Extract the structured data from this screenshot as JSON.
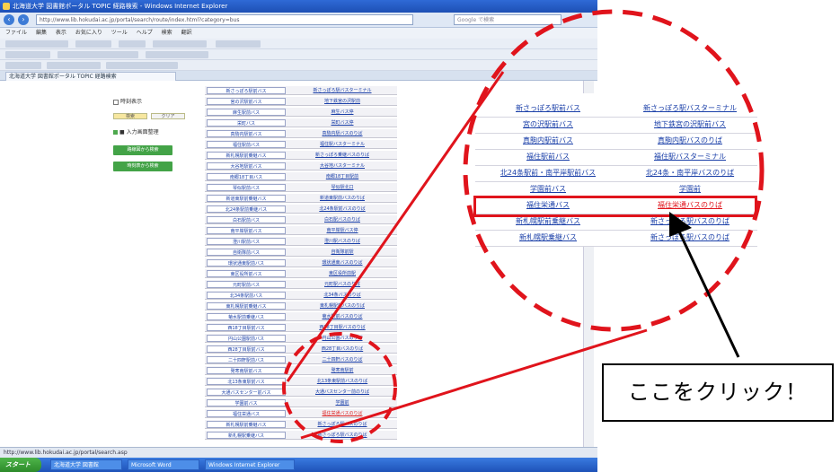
{
  "window": {
    "title": "北海道大学 図書館ポータル TOPIC 経路検索 - Windows Internet Explorer",
    "url": "http://www.lib.hokudai.ac.jp/portal/search/route/index.html?category=bus",
    "search_placeholder": "Google で検索"
  },
  "menubar": [
    "ファイル",
    "編集",
    "表示",
    "お気に入り",
    "ツール",
    "ヘルプ",
    "検索",
    "翻訳"
  ],
  "tab": {
    "label": "北海道大学 図書館ポータル TOPIC 経路検索"
  },
  "left_panel": {
    "checkbox_label": "時刻表示",
    "mini_buttons": [
      "検索",
      "クリア"
    ],
    "green_label": "■ 入力画面整理",
    "green_buttons": [
      "路線図から検索",
      "時刻表から検索"
    ]
  },
  "route_table": [
    {
      "left": "新さっぽろ駅前バス",
      "right": "新さっぽろ駅バスターミナル",
      "red": false
    },
    {
      "left": "宮の沢駅前バス",
      "right": "地下鉄宮の沢駅前",
      "red": false
    },
    {
      "left": "麻生駅前バス",
      "right": "麻生バス停",
      "red": false
    },
    {
      "left": "栄町バス",
      "right": "栄町バス停",
      "red": false
    },
    {
      "left": "真駒内駅前バス",
      "right": "真駒内駅バスのりば",
      "red": false
    },
    {
      "left": "福住駅前バス",
      "right": "福住駅バスターミナル",
      "red": false
    },
    {
      "left": "新札幌駅前乗継バス",
      "right": "新さっぽろ乗継バスのりば",
      "red": false
    },
    {
      "left": "大谷地駅前バス",
      "right": "大谷地バスターミナル",
      "red": false
    },
    {
      "left": "南郷18丁目バス",
      "right": "南郷18丁目駅前",
      "red": false
    },
    {
      "left": "琴似駅前バス",
      "right": "琴似駅北口",
      "red": false
    },
    {
      "left": "新道東駅前乗継バス",
      "right": "新道東駅前バスのりば",
      "red": false
    },
    {
      "left": "北24条駅前乗継バス",
      "right": "北24条駅前バスのりば",
      "red": false
    },
    {
      "left": "白石駅前バス",
      "right": "白石駅バスのりば",
      "red": false
    },
    {
      "left": "南平岸駅前バス",
      "right": "南平岸駅バス停",
      "red": false
    },
    {
      "left": "澄川駅前バス",
      "right": "澄川駅バスのりば",
      "red": false
    },
    {
      "left": "自衛隊前バス",
      "right": "自衛隊前駅",
      "red": false
    },
    {
      "left": "環状通東駅前バス",
      "right": "環状通東バスのりば",
      "red": false
    },
    {
      "left": "東区役所前バス",
      "right": "東区役所前駅",
      "red": false
    },
    {
      "left": "元町駅前バス",
      "right": "元町駅バスのりば",
      "red": false
    },
    {
      "left": "北34条駅前バス",
      "right": "北34条バスのりば",
      "red": false
    },
    {
      "left": "東札幌駅前乗継バス",
      "right": "東札幌駅前バスのりば",
      "red": false
    },
    {
      "left": "菊水駅前乗継バス",
      "right": "菊水駅前バスのりば",
      "red": false
    },
    {
      "left": "西18丁目駅前バス",
      "right": "西18丁目駅バスのりば",
      "red": false
    },
    {
      "left": "円山公園駅前バス",
      "right": "円山公園バスのりば",
      "red": false
    },
    {
      "left": "西28丁目駅前バス",
      "right": "西28丁目バスのりば",
      "red": false
    },
    {
      "left": "二十四軒駅前バス",
      "right": "二十四軒バスのりば",
      "red": false
    },
    {
      "left": "発寒南駅前バス",
      "right": "発寒南駅前",
      "red": false
    },
    {
      "left": "北13条東駅前バス",
      "right": "北13条東駅前バスのりば",
      "red": false
    },
    {
      "left": "大通バスセンター前バス",
      "right": "大通バスセンター前のりば",
      "red": false
    },
    {
      "left": "学園前バス",
      "right": "学園前",
      "red": false
    },
    {
      "left": "福住栄通バス",
      "right": "福住栄通バスのりば",
      "red": true
    },
    {
      "left": "新札幌駅前乗継バス",
      "right": "新さっぽろ駅バスのりば",
      "red": false
    },
    {
      "left": "新札幌駅乗継バス",
      "right": "新さっぽろ駅バスのりば",
      "red": false
    }
  ],
  "zoom_rows": [
    {
      "left": "新さっぽろ駅前バス",
      "right": "新さっぽろ駅バスターミナル",
      "red": false
    },
    {
      "left": "宮の沢駅前バス",
      "right": "地下鉄宮の沢駅前バス",
      "red": false
    },
    {
      "left": "真駒内駅前バス",
      "right": "真駒内駅バスのりば",
      "red": false
    },
    {
      "left": "福住駅前バス",
      "right": "福住駅バスターミナル",
      "red": false
    },
    {
      "left": "北24条駅前・南平岸駅前バス",
      "right": "北24条・南平岸バスのりば",
      "red": false
    },
    {
      "left": "学園前バス",
      "right": "学園前",
      "red": false
    },
    {
      "left": "福住栄通バス",
      "right": "福住栄通バスのりば",
      "red": true
    },
    {
      "left": "新札幌駅前乗継バス",
      "right": "新さっぽろ駅バスのりば",
      "red": false
    },
    {
      "left": "新札幌駅乗継バス",
      "right": "新さっぽろ駅バスのりば",
      "red": false
    }
  ],
  "statusbar": {
    "text": "http://www.lib.hokudai.ac.jp/portal/search.asp"
  },
  "taskbar": {
    "start_label": "スタート",
    "items": [
      "北海道大学 図書館",
      "Microsoft Word",
      "Windows Internet Explorer"
    ]
  },
  "callout": {
    "text": "ここをクリック！"
  },
  "colors": {
    "annotation_red": "#e0141c",
    "link_blue": "#1a3fa8",
    "xp_blue": "#1d4fb4"
  }
}
